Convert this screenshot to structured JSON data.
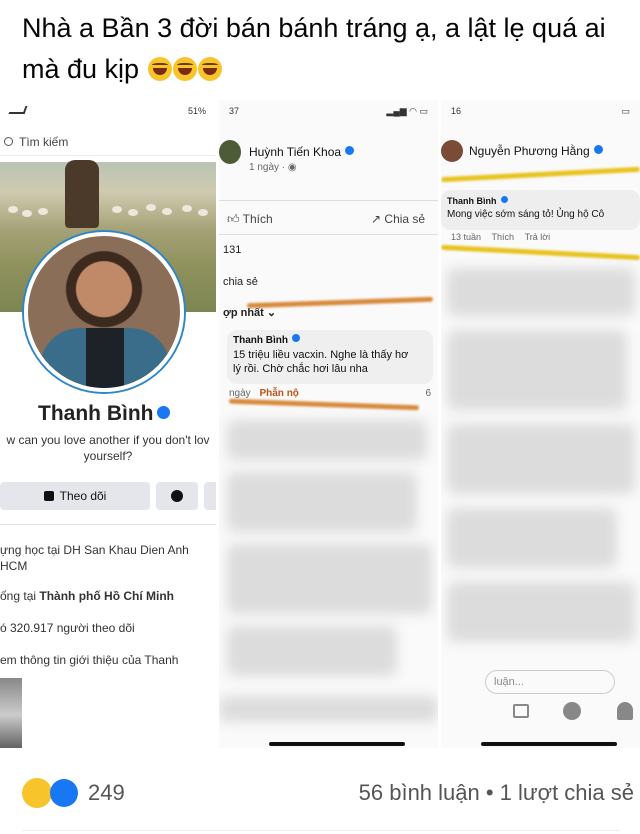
{
  "post": {
    "text": "Nhà a Bần 3 đời bán bánh tráng ạ, a lật lẹ quá ai mà đu kịp"
  },
  "screen1": {
    "status_battery": "51%",
    "search_placeholder": "Tìm kiếm",
    "profile_name": "Thanh Bình",
    "bio": "w can you love another if you don't lov yourself?",
    "follow_label": "Theo dõi",
    "info_study": "ựng học tại DH San Khau Dien Anh HCM",
    "info_live_prefix": "ống tại ",
    "info_live_city": "Thành phố Hồ Chí Minh",
    "info_followers": "ó 320.917 người theo dõi",
    "info_more": "em thông tin giới thiệu của Thanh"
  },
  "screen2": {
    "status_left": "37",
    "author": "Huỳnh Tiến Khoa",
    "time": "1 ngày · ",
    "like_label": "Thích",
    "share_label": "Chia sẻ",
    "reactions_count": "131",
    "shares_label": "chia sẻ",
    "sort_label": "ợp nhất",
    "commenter": "Thanh Bình",
    "comment_line1": "15 triệu liều vacxin. Nghe là thấy hơ",
    "comment_line2": "lý rồi. Chờ chắc hơi lâu nha",
    "meta_time": "ngày",
    "meta_react": "Phẫn nộ",
    "meta_num": "6"
  },
  "screen3": {
    "status_left": "16",
    "author": "Nguyễn Phương Hằng",
    "commenter": "Thanh Bình",
    "comment": "Mong việc sớm sáng tỏ! Ủng hộ Cô",
    "meta_time": "13 tuần",
    "meta_like": "Thích",
    "meta_reply": "Trả lời",
    "comment_box": "luận..."
  },
  "footer": {
    "reaction_count": "249",
    "stats": "56 bình luận • 1 lượt chia sẻ"
  },
  "colors": {
    "accent": "#1877f2",
    "highlight_orange": "#d88a3c",
    "highlight_yellow": "#e8c21c"
  }
}
